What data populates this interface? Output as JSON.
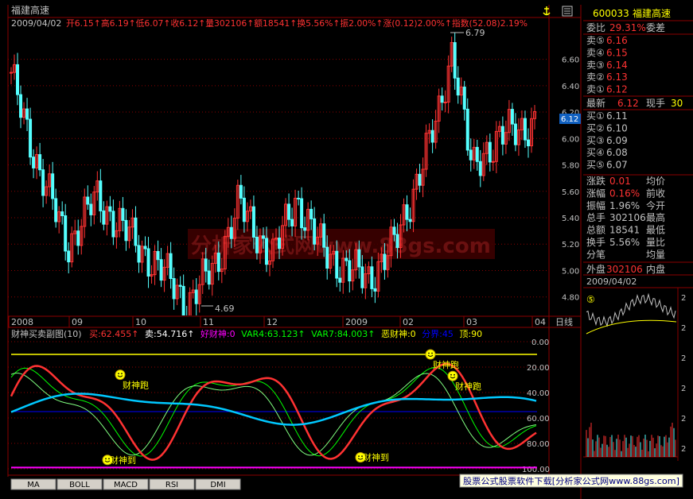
{
  "colors": {
    "up": "#ff3232",
    "down": "#54ffff",
    "grid": "#8b0000",
    "label": "#c0c0c0",
    "yellow": "#ffff00",
    "green": "#00ff00",
    "cyan": "#00c8ff",
    "magenta": "#ff00ff",
    "blue": "#0000ff"
  },
  "main": {
    "stock_name": "福建高速",
    "date": "2009/04/02",
    "ohlc_text": "开6.15↑高6.19↑低6.07↑收6.12↑量302106↑额18541↑换5.56%↑振2.00%↑涨(0.12)2.00%↑指数(52.08)2.19%",
    "max_label": "6.79",
    "min_label": "4.69",
    "current_price_tag": "6.12",
    "watermark": "分析家公式网www.88gs.com",
    "anchor_icon": "anchor-icon",
    "menu_icon": "menu-icon"
  },
  "x_axis": {
    "labels": [
      "2008",
      "09",
      "10",
      "11",
      "12",
      "2009",
      "02",
      "03",
      "04"
    ],
    "right_label": "日线"
  },
  "indicator": {
    "title": "财神买卖副图(10)",
    "buy": "买:62.455↑",
    "sell": "卖:54.716↑",
    "good": "好财神:0",
    "var4": "VAR4:63.123↑",
    "var7": "VAR7:84.003↑",
    "bad": "恶财神:0",
    "fen": "分界:45",
    "top": "顶:90",
    "y_labels": [
      "100.00",
      "80.00",
      "60.00",
      "40.00",
      "20.00",
      "0.00"
    ],
    "signal_run": "财神跑",
    "signal_come": "财神到",
    "smiley_icon": "smiley-icon"
  },
  "tabs": [
    "MA",
    "BOLL",
    "MACD",
    "RSI",
    "DMI"
  ],
  "ad_banner": "股票公式股票软件下载[分析家公式网www.88gs.com]",
  "quote": {
    "code": "600033",
    "name": "福建高速",
    "weibi_label": "委比",
    "weibi_value": "29.31%",
    "weicha_label": "委差",
    "sells": [
      {
        "label": "卖⑤",
        "price": "6.16"
      },
      {
        "label": "卖④",
        "price": "6.15"
      },
      {
        "label": "卖③",
        "price": "6.14"
      },
      {
        "label": "卖②",
        "price": "6.13"
      },
      {
        "label": "卖①",
        "price": "6.12"
      }
    ],
    "latest_label": "最新",
    "latest_value": "6.12",
    "xianshou_label": "现手",
    "xianshou_value": "30",
    "buys": [
      {
        "label": "买①",
        "price": "6.11"
      },
      {
        "label": "买②",
        "price": "6.10"
      },
      {
        "label": "买③",
        "price": "6.09"
      },
      {
        "label": "买④",
        "price": "6.08"
      },
      {
        "label": "买⑤",
        "price": "6.07"
      }
    ],
    "stats": [
      {
        "label": "涨跌",
        "value": "0.01",
        "label2": "均价"
      },
      {
        "label": "涨幅",
        "value": "0.16%",
        "label2": "前收"
      },
      {
        "label": "振幅",
        "value": "1.96%",
        "label2": "今开"
      },
      {
        "label": "总手",
        "value": "302106",
        "label2": "最高"
      },
      {
        "label": "总额",
        "value": "18541",
        "label2": "最低"
      },
      {
        "label": "换手",
        "value": "5.56%",
        "label2": "量比"
      },
      {
        "label": "分笔",
        "value": "",
        "label2": "均量"
      }
    ],
    "waipan_label": "外盘",
    "waipan_value": "302106",
    "neipan_label": "内盘",
    "mini_date": "2009/04/02",
    "mini_badge": "⑤",
    "mini_right_labels": [
      "2",
      "2",
      "2",
      "2",
      "2",
      "2"
    ]
  },
  "chart_data": [
    {
      "type": "candlestick",
      "title": "福建高速",
      "ylim": [
        4.6,
        6.85
      ],
      "y_ticks": [
        4.8,
        5.0,
        5.2,
        5.4,
        5.6,
        5.8,
        6.0,
        6.2,
        6.4,
        6.6
      ],
      "y_tick_labels": [
        "4.80",
        "5.00",
        "5.20",
        "5.40",
        "5.60",
        "5.80",
        "6.00",
        "6.20",
        "6.40",
        "6.60"
      ],
      "x_labels": [
        "2008",
        "09",
        "10",
        "11",
        "12",
        "2009",
        "02",
        "03",
        "04"
      ],
      "max": 6.79,
      "min": 4.69,
      "last_close": 6.12
    },
    {
      "type": "line",
      "title": "财神买卖副图(10)",
      "ylim": [
        0,
        100
      ],
      "y_ticks": [
        0,
        20,
        40,
        60,
        80,
        100
      ],
      "levels": {
        "top": 90,
        "fenjie": 45,
        "bottom": 0
      },
      "series": [
        {
          "name": "买",
          "last": 62.455
        },
        {
          "name": "卖",
          "last": 54.716
        },
        {
          "name": "VAR4",
          "last": 63.123
        },
        {
          "name": "VAR7",
          "last": 84.003
        }
      ]
    }
  ]
}
